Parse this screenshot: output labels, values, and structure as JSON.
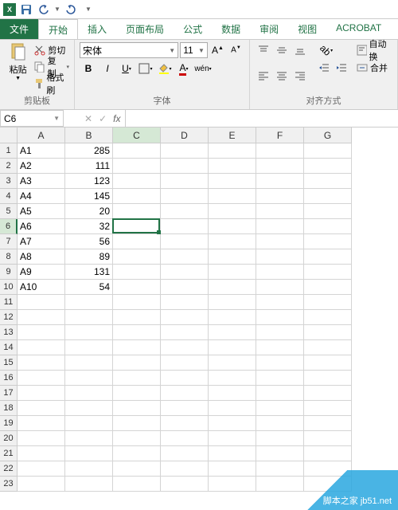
{
  "qat": {
    "save_title": "保存",
    "undo_title": "撤销",
    "redo_title": "重做"
  },
  "tabs": {
    "file": "文件",
    "home": "开始",
    "insert": "插入",
    "layout": "页面布局",
    "formula": "公式",
    "data": "数据",
    "review": "审阅",
    "view": "视图",
    "acrobat": "ACROBAT"
  },
  "ribbon": {
    "clipboard": {
      "paste": "粘贴",
      "cut": "剪切",
      "copy": "复制",
      "format_painter": "格式刷",
      "label": "剪贴板"
    },
    "font": {
      "name": "宋体",
      "size": "11",
      "label": "字体"
    },
    "align": {
      "wrap": "自动换",
      "merge": "合并",
      "label": "对齐方式"
    }
  },
  "namebox": "C6",
  "formula": "",
  "columns": [
    "A",
    "B",
    "C",
    "D",
    "E",
    "F",
    "G"
  ],
  "selected_col": "C",
  "selected_row": 6,
  "active_cell": {
    "col": 2,
    "row": 5
  },
  "row_count": 23,
  "data": {
    "A": [
      "A1",
      "A2",
      "A3",
      "A4",
      "A5",
      "A6",
      "A7",
      "A8",
      "A9",
      "A10"
    ],
    "B": [
      285,
      111,
      123,
      145,
      20,
      32,
      56,
      89,
      131,
      54
    ]
  },
  "watermark": "脚本之家 jb51.net"
}
